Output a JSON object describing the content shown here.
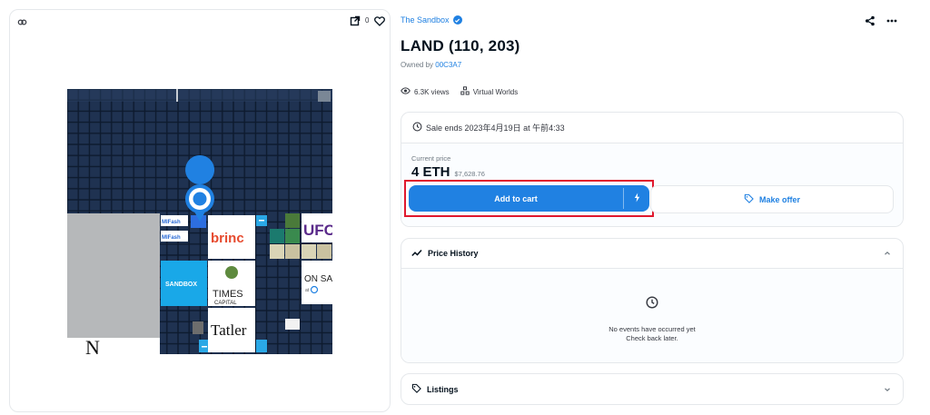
{
  "media": {
    "like_count": "0"
  },
  "map": {
    "labels": {
      "brinc": "brinc",
      "sandbox": "SANDBOX",
      "times": "TIMES",
      "capital": "CAPITAL",
      "tatler": "Tatler",
      "ufc": "UFC",
      "onsa": "ON SA",
      "at": "at",
      "mif1": "MIFash",
      "mif2": "MIFash",
      "n_letter": "N"
    }
  },
  "collection": {
    "name": "The Sandbox"
  },
  "item": {
    "title": "LAND (110, 203)",
    "owned_by_label": "Owned by",
    "owner": "00C3A7"
  },
  "stats": {
    "views": "6.3K views",
    "category": "Virtual Worlds"
  },
  "sale": {
    "ends": "Sale ends 2023年4月19日 at 午前4:33",
    "current_price_label": "Current price",
    "price": "4 ETH",
    "usd": "$7,628.76",
    "add_to_cart": "Add to cart",
    "make_offer": "Make offer"
  },
  "price_history": {
    "title": "Price History",
    "empty": "No events have occurred yet",
    "check_back": "Check back later."
  },
  "listings": {
    "title": "Listings"
  },
  "colors": {
    "accent": "#2081e2",
    "highlight_border": "#e0182d",
    "map_dark": "#1f3251",
    "map_grid": "#0d1a2e"
  }
}
